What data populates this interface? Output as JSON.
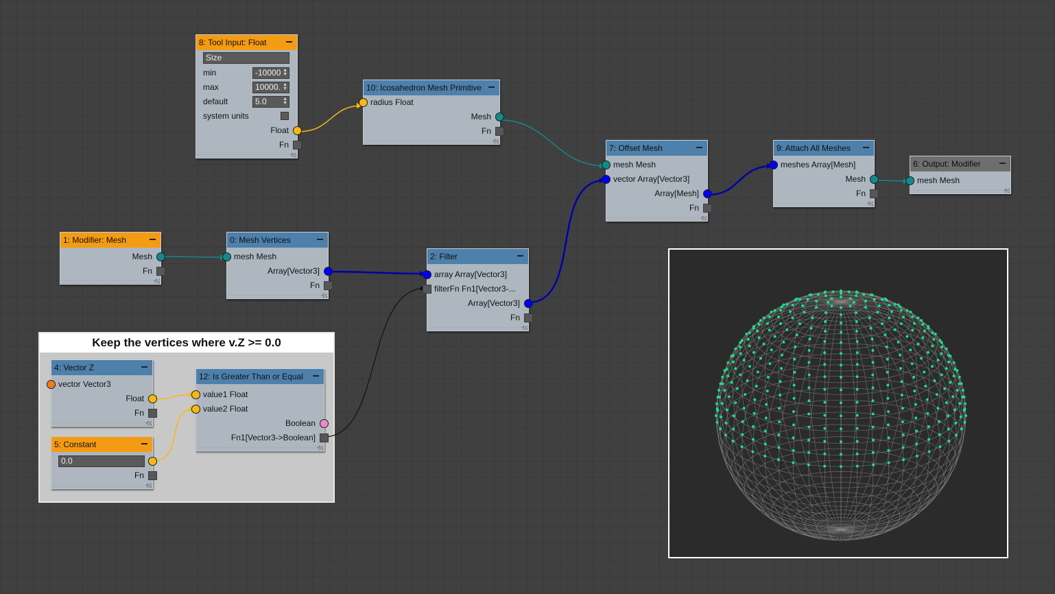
{
  "nodes": {
    "tool_input": {
      "title": "8: Tool Input: Float",
      "name_field": "Size",
      "min_label": "min",
      "min_value": "-10000",
      "max_label": "max",
      "max_value": "10000.",
      "default_label": "default",
      "default_value": "5.0",
      "system_units_label": "system units",
      "out_float": "Float",
      "out_fn": "Fn"
    },
    "icosahedron": {
      "title": "10: Icosahedron Mesh Primitive",
      "in_radius": "radius Float",
      "out_mesh": "Mesh",
      "out_fn": "Fn"
    },
    "offset_mesh": {
      "title": "7: Offset Mesh",
      "in_mesh": "mesh Mesh",
      "in_vector": "vector Array[Vector3]",
      "out_array": "Array[Mesh]",
      "out_fn": "Fn"
    },
    "attach_all": {
      "title": "9: Attach All Meshes",
      "in_meshes": "meshes Array[Mesh]",
      "out_mesh": "Mesh",
      "out_fn": "Fn"
    },
    "output_modifier": {
      "title": "6: Output: Modifier",
      "in_mesh": "mesh Mesh"
    },
    "modifier_mesh": {
      "title": "1: Modifier: Mesh",
      "out_mesh": "Mesh",
      "out_fn": "Fn"
    },
    "mesh_vertices": {
      "title": "0: Mesh Vertices",
      "in_mesh": "mesh Mesh",
      "out_array": "Array[Vector3]",
      "out_fn": "Fn"
    },
    "filter": {
      "title": "2: Filter",
      "in_array": "array Array[Vector3]",
      "in_filterfn": "filterFn Fn1[Vector3-...",
      "out_array": "Array[Vector3]",
      "out_fn": "Fn"
    },
    "vector_z": {
      "title": "4: Vector Z",
      "in_vector": "vector Vector3",
      "out_float": "Float",
      "out_fn": "Fn"
    },
    "constant": {
      "title": "5: Constant",
      "value": "0.0",
      "out_fn": "Fn"
    },
    "greater_equal": {
      "title": "12: Is Greater Than or Equal",
      "in_value1": "value1 Float",
      "in_value2": "value2 Float",
      "out_boolean": "Boolean",
      "out_fn1": "Fn1[Vector3->Boolean]"
    }
  },
  "group": {
    "title": "Keep the vertices where v.Z >= 0.0"
  },
  "colors": {
    "header_blue": "#4d80ab",
    "header_orange": "#f49b14",
    "header_gray": "#6e6e6e",
    "node_body": "#aeb6bf",
    "port_teal": "#15888b",
    "port_yellow": "#f7b817",
    "port_blue": "#0000f0",
    "port_pink": "#f08ac8",
    "wire_black": "#111111",
    "vertex_green": "#17e08a"
  },
  "icons": [
    "minimize-icon",
    "spinner-icon",
    "checkbox-icon",
    "resize-grip-icon"
  ]
}
